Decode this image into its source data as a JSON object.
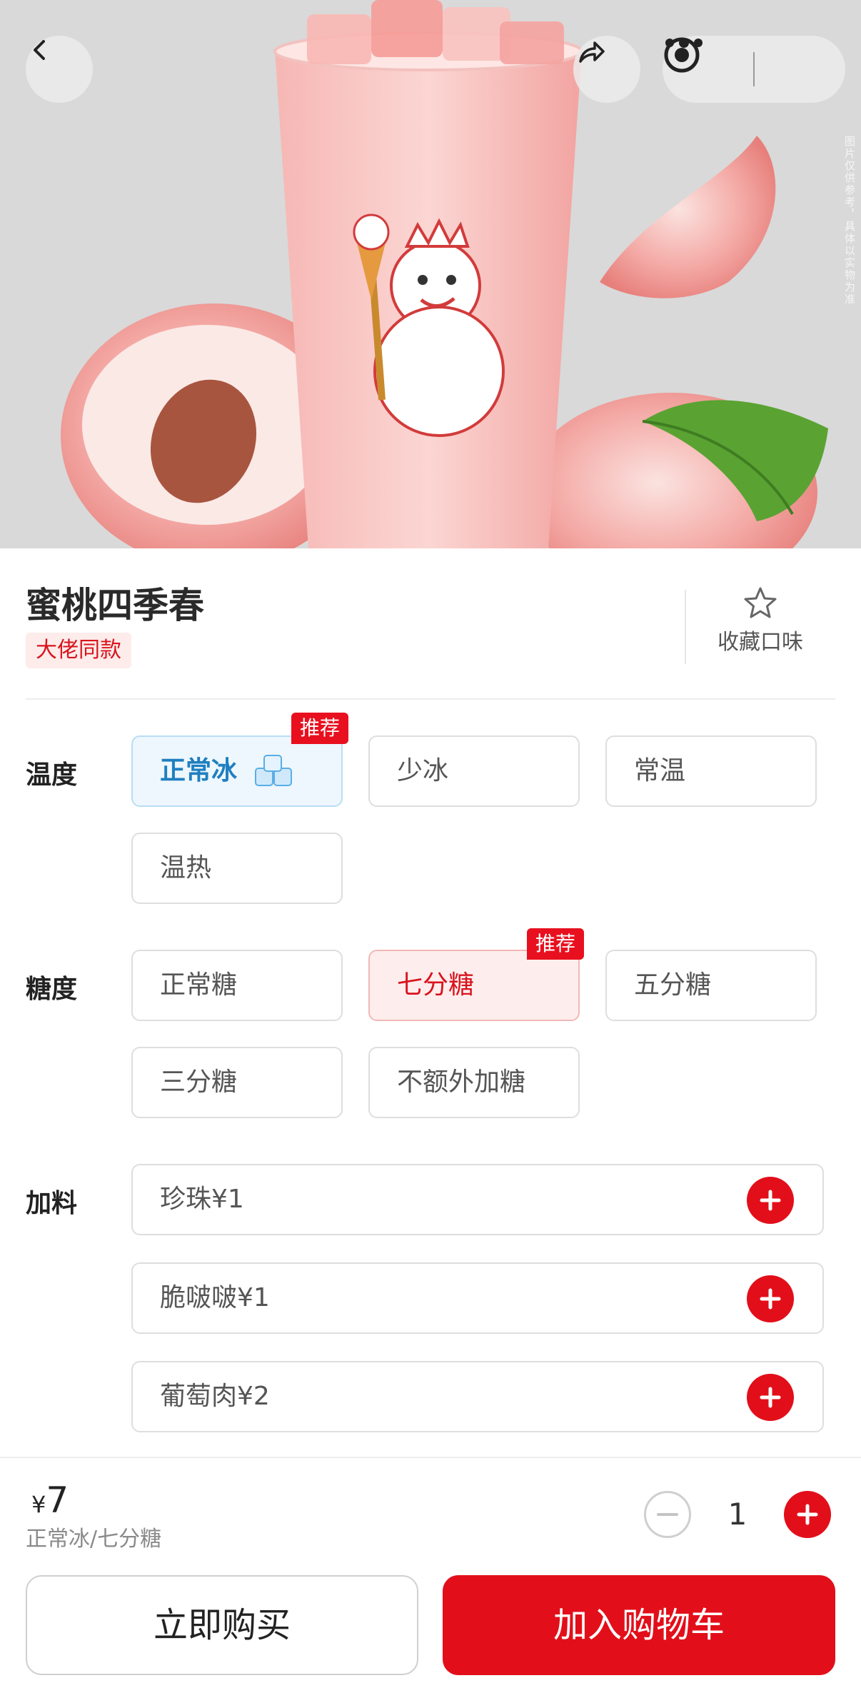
{
  "nav": {
    "back_icon": "chevron-left-icon",
    "share_icon": "share-icon",
    "more_icon": "more-dots-icon",
    "close_icon": "target-circle-icon"
  },
  "hero": {
    "watermark": "图片仅供参考，具体以实物为准",
    "colors": {
      "background": "#d9d9d9",
      "peach": "#f3a6a4",
      "drink": "#f7c3c1",
      "leaf": "#5aa332"
    }
  },
  "product": {
    "name": "蜜桃四季春",
    "tag": "大佬同款",
    "favorite_label": "收藏口味",
    "favorite_icon": "star-outline-icon"
  },
  "temperature": {
    "label": "温度",
    "badge": "推荐",
    "options": [
      "正常冰",
      "少冰",
      "常温",
      "温热"
    ],
    "selected": "正常冰",
    "selected_icon": "ice-cube-icon"
  },
  "sweetness": {
    "label": "糖度",
    "badge": "推荐",
    "options": [
      "正常糖",
      "七分糖",
      "五分糖",
      "三分糖",
      "不额外加糖"
    ],
    "selected": "七分糖"
  },
  "toppings": {
    "label": "加料",
    "items": [
      {
        "name": "珍珠¥1"
      },
      {
        "name": "脆啵啵¥1"
      },
      {
        "name": "葡萄肉¥2"
      }
    ],
    "add_icon": "plus-icon"
  },
  "footer": {
    "currency": "¥",
    "price": "7",
    "summary": "正常冰/七分糖",
    "quantity": "1",
    "buy_now": "立即购买",
    "add_to_cart": "加入购物车",
    "accent": "#e20f1a"
  }
}
